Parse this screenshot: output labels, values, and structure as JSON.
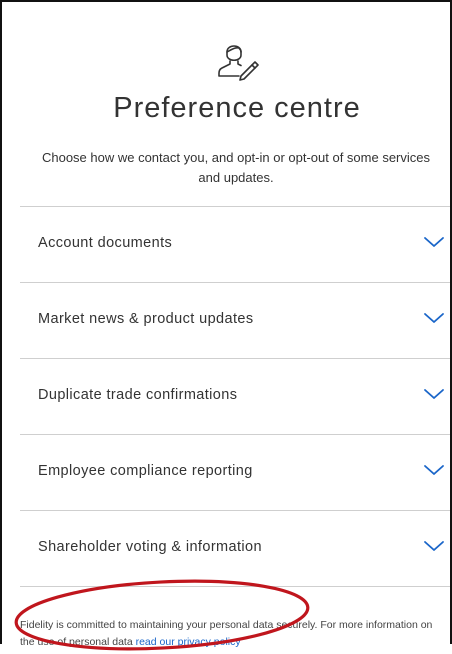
{
  "header": {
    "icon": "user-edit-icon",
    "title": "Preference centre",
    "subtitle": "Choose how we contact you, and opt-in or opt-out of some services and updates."
  },
  "accordion": {
    "items": [
      {
        "label": "Account documents",
        "expanded": false
      },
      {
        "label": "Market news & product updates",
        "expanded": false
      },
      {
        "label": "Duplicate trade confirmations",
        "expanded": false
      },
      {
        "label": "Employee compliance reporting",
        "expanded": false
      },
      {
        "label": "Shareholder voting & information",
        "expanded": false
      }
    ],
    "chevron_icon": "chevron-down-icon"
  },
  "annotation": {
    "shape": "ellipse",
    "target": "Shareholder voting & information",
    "color": "#c0161d"
  },
  "footer": {
    "text": "Fidelity is committed to maintaining your personal data securely. For more information on the use of personal data ",
    "link_label": "read our privacy policy"
  },
  "colors": {
    "accent": "#1a66c9",
    "text": "#333333",
    "divider": "#cfcfcf",
    "frame_border": "#111111"
  }
}
